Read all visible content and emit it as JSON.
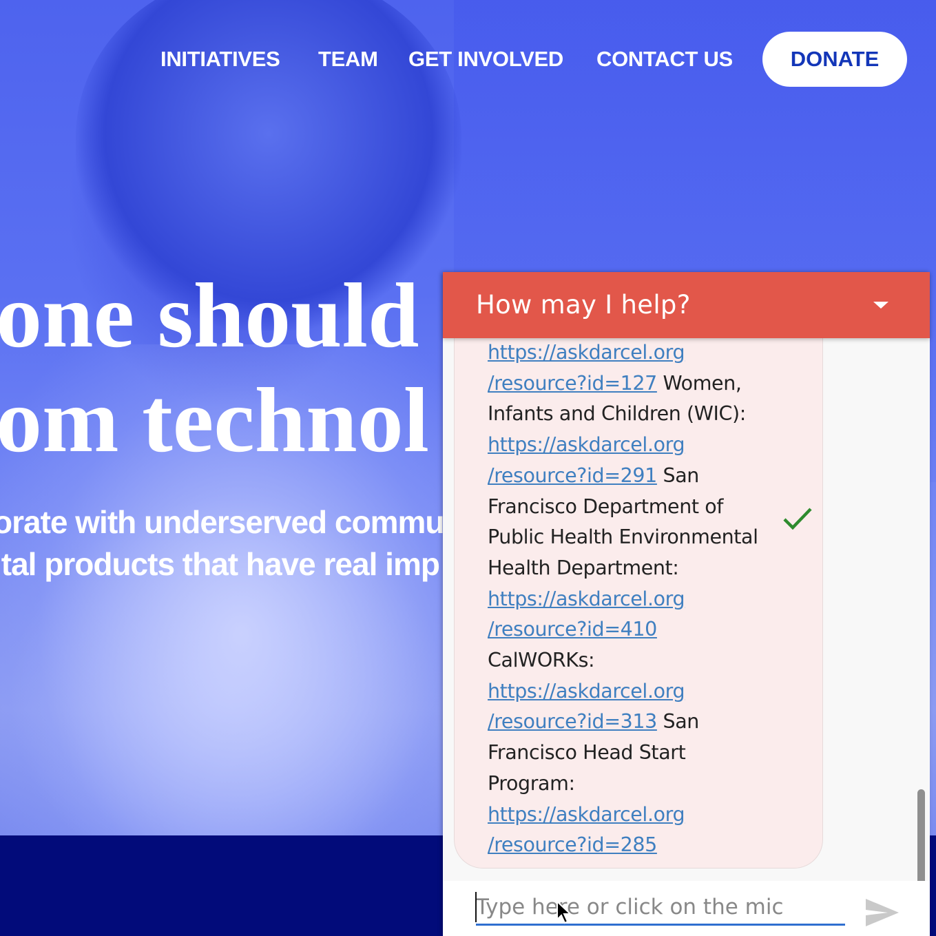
{
  "nav": {
    "items": [
      "INITIATIVES",
      "TEAM",
      "GET INVOLVED",
      "CONTACT US"
    ],
    "donate_label": "DONATE"
  },
  "hero": {
    "headline_lines": [
      "one should",
      "om technol"
    ],
    "subline_lines": [
      "orate with underserved commu",
      "ital products that have real imp"
    ]
  },
  "chat": {
    "title": "How may I help?",
    "message_lines": [
      {
        "link": "https://askdarcel.org",
        "text": ""
      },
      {
        "link": "/resource?id=127",
        "text": " Women,"
      },
      {
        "link": "",
        "text": "Infants and Children (WIC):"
      },
      {
        "link": "https://askdarcel.org",
        "text": ""
      },
      {
        "link": "/resource?id=291",
        "text": " San"
      },
      {
        "link": "",
        "text": "Francisco Department of"
      },
      {
        "link": "",
        "text": "Public Health Environmental"
      },
      {
        "link": "",
        "text": "Health Department:"
      },
      {
        "link": "https://askdarcel.org",
        "text": ""
      },
      {
        "link": "/resource?id=410",
        "text": ""
      },
      {
        "link": "",
        "text": "CalWORKs:"
      },
      {
        "link": "https://askdarcel.org",
        "text": ""
      },
      {
        "link": "/resource?id=313",
        "text": " San"
      },
      {
        "link": "",
        "text": "Francisco Head Start"
      },
      {
        "link": "",
        "text": "Program:"
      },
      {
        "link": "https://askdarcel.org",
        "text": ""
      },
      {
        "link": "/resource?id=285",
        "text": ""
      }
    ],
    "input_placeholder": "Type here or click on the mic",
    "status_icon": "check-icon",
    "colors": {
      "header": "#e2574a",
      "link": "#3f7fc0",
      "check": "#2e8b2e"
    }
  },
  "colors": {
    "hero_blue": "#4e63ee",
    "footer_band": "#020b7a",
    "donate_text": "#1336b8"
  }
}
